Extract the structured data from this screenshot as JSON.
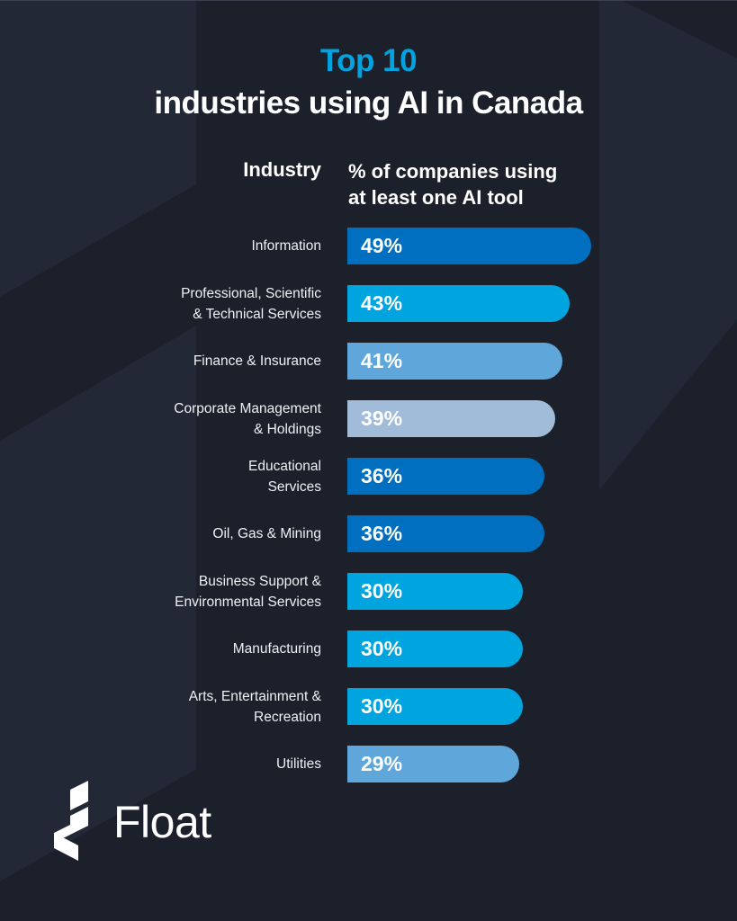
{
  "header": {
    "title_accent": "Top 10",
    "title_main": "industries using AI in Canada"
  },
  "columns": {
    "industry": "Industry",
    "percent_line1": "% of companies using",
    "percent_line2": "at least one AI tool"
  },
  "brand": {
    "name": "Float",
    "logo_icon": "float-logo-icon"
  },
  "colors": {
    "background": "#1b202b",
    "accent": "#00a3e0",
    "bar_dark_blue": "#006fc0",
    "bar_cyan": "#00a5e0",
    "bar_mid_blue": "#5fa6da",
    "bar_pale_blue": "#a1bcd8"
  },
  "chart_data": {
    "type": "bar",
    "orientation": "horizontal",
    "title": "Top 10 industries using AI in Canada",
    "xlabel": "% of companies using at least one AI tool",
    "ylabel": "Industry",
    "categories": [
      [
        "Information"
      ],
      [
        "Professional, Scientific",
        "& Technical Services"
      ],
      [
        "Finance & Insurance"
      ],
      [
        "Corporate Management",
        "& Holdings"
      ],
      [
        "Educational",
        "Services"
      ],
      [
        "Oil, Gas & Mining"
      ],
      [
        "Business Support &",
        "Environmental Services"
      ],
      [
        "Manufacturing"
      ],
      [
        "Arts, Entertainment &",
        "Recreation"
      ],
      [
        "Utilities"
      ]
    ],
    "values": [
      49,
      43,
      41,
      39,
      36,
      36,
      30,
      30,
      30,
      29
    ],
    "value_labels": [
      "49%",
      "43%",
      "41%",
      "39%",
      "36%",
      "36%",
      "30%",
      "30%",
      "30%",
      "29%"
    ],
    "bar_colors": [
      "#006fc0",
      "#00a5e0",
      "#5fa6da",
      "#a1bcd8",
      "#006fc0",
      "#006fc0",
      "#00a5e0",
      "#00a5e0",
      "#00a5e0",
      "#5fa6da"
    ],
    "unit": "%",
    "grid": false,
    "legend": "none"
  }
}
